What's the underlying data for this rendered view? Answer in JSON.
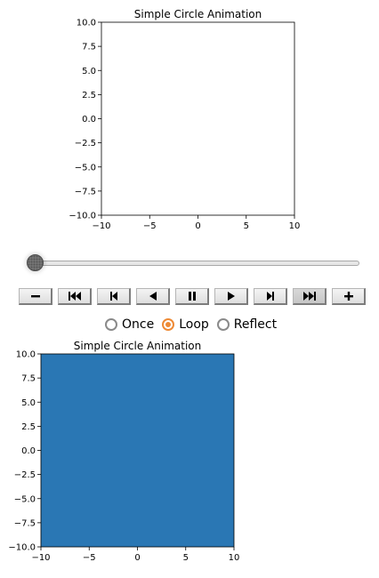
{
  "chart_data": [
    {
      "type": "scatter",
      "title": "Simple Circle Animation",
      "xlim": [
        -10,
        10
      ],
      "ylim": [
        -10,
        10
      ],
      "x_ticks": [
        "−10",
        "−5",
        "0",
        "5",
        "10"
      ],
      "y_ticks": [
        "10.0",
        "7.5",
        "5.0",
        "2.5",
        "0.0",
        "−2.5",
        "−5.0",
        "−7.5",
        "−10.0"
      ],
      "grid": false,
      "fill": false,
      "fill_color": "#ffffff"
    },
    {
      "type": "scatter",
      "title": "Simple Circle Animation",
      "xlim": [
        -10,
        10
      ],
      "ylim": [
        -10,
        10
      ],
      "x_ticks": [
        "−10",
        "−5",
        "0",
        "5",
        "10"
      ],
      "y_ticks": [
        "10.0",
        "7.5",
        "5.0",
        "2.5",
        "0.0",
        "−2.5",
        "−5.0",
        "−7.5",
        "−10.0"
      ],
      "grid": false,
      "fill": true,
      "fill_color": "#2a77b4"
    }
  ],
  "slider": {
    "value": 0,
    "thumb_icon": "slider-thumb"
  },
  "controls": [
    {
      "name": "slower-button",
      "icon": "minus-icon"
    },
    {
      "name": "first-frame-button",
      "icon": "skip-to-start-icon"
    },
    {
      "name": "previous-frame-button",
      "icon": "step-back-icon"
    },
    {
      "name": "play-reverse-button",
      "icon": "play-reverse-icon"
    },
    {
      "name": "pause-button",
      "icon": "pause-icon"
    },
    {
      "name": "play-button",
      "icon": "play-icon"
    },
    {
      "name": "next-frame-button",
      "icon": "step-forward-icon"
    },
    {
      "name": "last-frame-button",
      "icon": "skip-to-end-icon",
      "active": true
    },
    {
      "name": "faster-button",
      "icon": "plus-icon"
    }
  ],
  "modes": {
    "options": [
      "Once",
      "Loop",
      "Reflect"
    ],
    "selected": "Loop",
    "accent_color": "#ee8a35"
  }
}
